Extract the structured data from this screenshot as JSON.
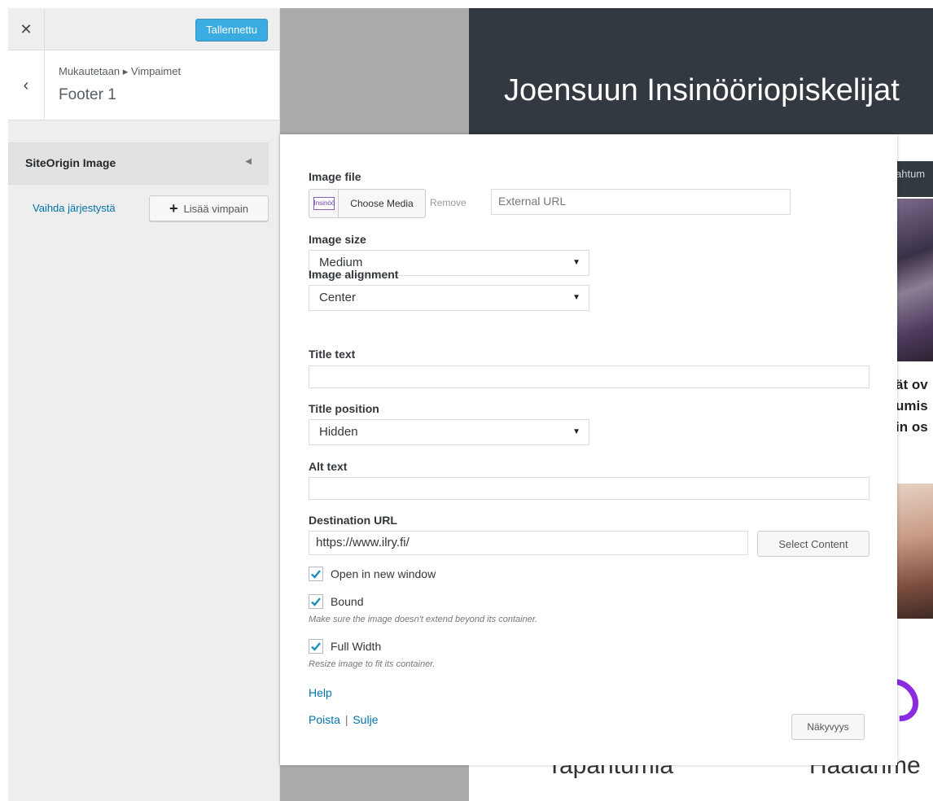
{
  "sidebar": {
    "close_icon": "close-icon",
    "save_button": "Tallennettu",
    "back_icon": "chevron-left-icon",
    "breadcrumb": "Mukautetaan ▸ Vimpaimet",
    "section_title": "Footer 1",
    "widget_title": "SiteOrigin Image",
    "reorder_link": "Vaihda järjestystä",
    "add_widget": "Lisää vimpain"
  },
  "preview": {
    "site_title": "Joensuun Insinööriopiskelijat",
    "nav_fragment": "ahtum",
    "text_fragment": [
      "ät ov",
      "umis",
      "in os"
    ],
    "bottom_left": "Tapahtumia",
    "bottom_right": "Haalarime"
  },
  "form": {
    "image_file_label": "Image file",
    "media_thumb_text": "Insinöö",
    "choose_media": "Choose Media",
    "remove": "Remove",
    "external_url_placeholder": "External URL",
    "image_size_label": "Image size",
    "image_size_value": "Medium",
    "image_alignment_label": "Image alignment",
    "image_alignment_value": "Center",
    "title_text_label": "Title text",
    "title_text_value": "",
    "title_position_label": "Title position",
    "title_position_value": "Hidden",
    "alt_text_label": "Alt text",
    "alt_text_value": "",
    "destination_url_label": "Destination URL",
    "destination_url_value": "https://www.ilry.fi/",
    "select_content": "Select Content",
    "open_new_window_label": "Open in new window",
    "open_new_window_checked": true,
    "bound_label": "Bound",
    "bound_checked": true,
    "bound_hint": "Make sure the image doesn't extend beyond its container.",
    "full_width_label": "Full Width",
    "full_width_checked": true,
    "full_width_hint": "Resize image to fit its container.",
    "help_link": "Help",
    "delete_link": "Poista",
    "separator": "|",
    "close_link": "Sulje",
    "visibility_button": "Näkyvyys"
  },
  "colors": {
    "accent": "#0073aa",
    "save_button": "#0096dd",
    "header_dark": "#333941"
  }
}
